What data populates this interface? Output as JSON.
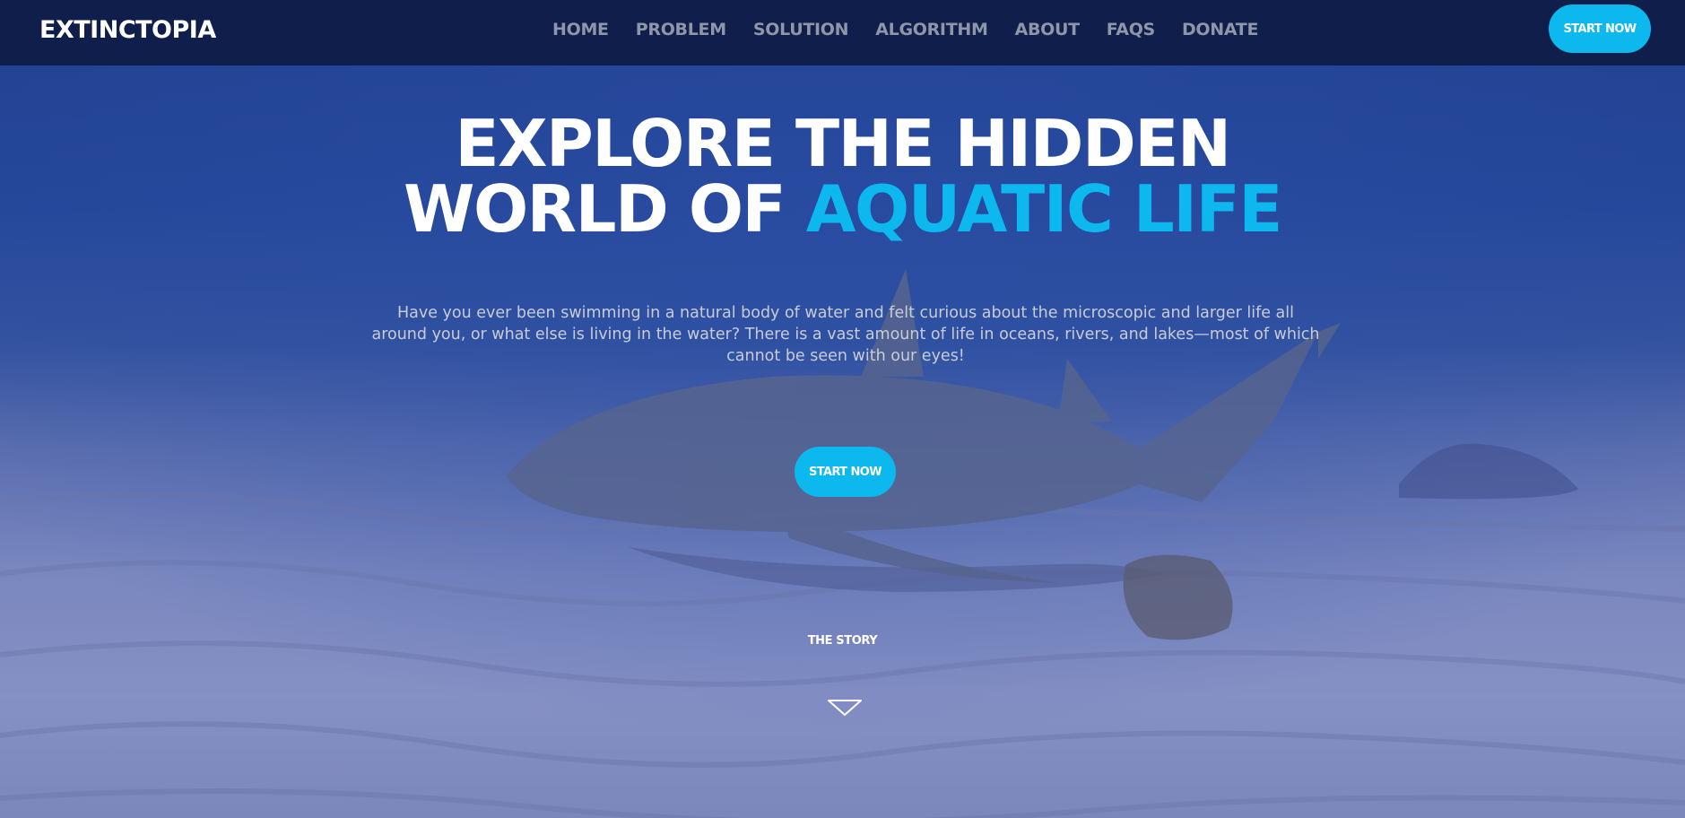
{
  "brand": "EXTINCTOPIA",
  "nav": {
    "links": [
      "HOME",
      "PROBLEM",
      "SOLUTION",
      "ALGORITHM",
      "ABOUT",
      "FAQS",
      "DONATE"
    ],
    "cta_label": "START NOW"
  },
  "hero": {
    "title_line1": "EXPLORE THE HIDDEN",
    "title_line2_white": "WORLD OF",
    "title_line2_accent": "AQUATIC LIFE",
    "subtitle": "Have you ever been swimming in a natural body of water and felt curious about the microscopic and larger life all around you, or what else is living in the water? There is a vast amount of life in oceans, rivers, and lakes—most of which cannot be seen with our eyes!",
    "cta_label": "START NOW",
    "story_label": "THE STORY",
    "down_icon": "chevron-down-icon"
  },
  "colors": {
    "navbar": "#0f1e4a",
    "accent": "#0db8ee",
    "nav_link": "#8f96a8",
    "text": "#ffffff",
    "subtitle": "#c8ccd6"
  }
}
